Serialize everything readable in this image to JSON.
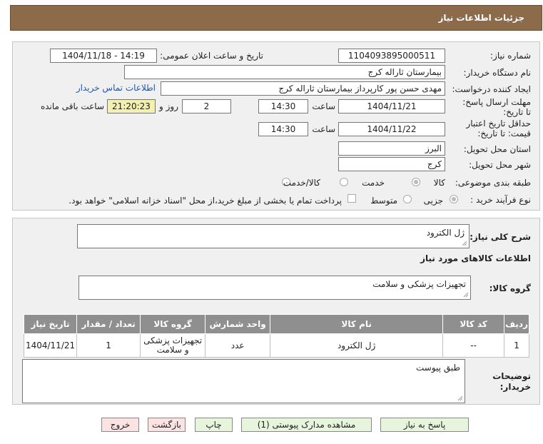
{
  "header": {
    "title": "جزئیات اطلاعات نیاز"
  },
  "form": {
    "need_number_label": "شماره نیاز:",
    "need_number": "1104093895000511",
    "announce_label": "تاریخ و ساعت اعلان عمومی:",
    "announce_value": "1404/11/18 - 14:19",
    "buyer_org_label": "نام دستگاه خریدار:",
    "buyer_org": "بیمارستان ثاراله کرج",
    "creator_label": "ایجاد کننده درخواست:",
    "creator": "مهدی حسن پور کارپرداز بیمارستان ثاراله کرج",
    "contact_link": "اطلاعات تماس خریدار",
    "deadline_label": "مهلت ارسال پاسخ: تا تاریخ:",
    "deadline_date": "1404/11/21",
    "time_label": "ساعت",
    "deadline_time": "14:30",
    "days_value": "2",
    "days_label": "روز و",
    "remaining_time": "21:20:23",
    "remaining_label": "ساعت باقی مانده",
    "validity_label": "حداقل تاریخ اعتبار قیمت: تا تاریخ:",
    "validity_date": "1404/11/22",
    "validity_time_label": "ساعت",
    "validity_time": "14:30",
    "province_label": "استان محل تحویل:",
    "province": "البرز",
    "city_label": "شهر محل تحویل:",
    "city": "کرج",
    "category_label": "طبقه بندی موضوعی:",
    "category_options": [
      "کالا",
      "خدمت",
      "کالا/خدمت"
    ],
    "purchase_type_label": "نوع فرآیند خرید :",
    "purchase_options": [
      "جزیی",
      "متوسط"
    ],
    "purchase_note": "پرداخت تمام یا بخشی از مبلغ خرید،از محل \"اسناد خزانه اسلامی\" خواهد بود."
  },
  "details": {
    "description_label": "شرح کلی نیاز:",
    "description": "ژل الکترود",
    "goods_info_title": "اطلاعات کالاهای مورد نیاز",
    "goods_group_label": "گروه کالا:",
    "goods_group": "تجهیزات پزشکی و سلامت",
    "buyer_notes_label": "توضیحات خریدار:",
    "buyer_notes": "طبق پیوست"
  },
  "table": {
    "headers": [
      "ردیف",
      "کد کالا",
      "نام کالا",
      "واحد شمارش",
      "گروه کالا",
      "تعداد / مقدار",
      "تاریخ نیاز"
    ],
    "rows": [
      [
        "1",
        "--",
        "ژل الکترود",
        "عدد",
        "تجهیزات پزشکی و سلامت",
        "1",
        "1404/11/21"
      ]
    ]
  },
  "buttons": {
    "reply": "پاسخ به نیاز",
    "attachments": "مشاهده مدارک پیوستی (1)",
    "print": "چاپ",
    "back": "بازگشت",
    "exit": "خروج"
  }
}
